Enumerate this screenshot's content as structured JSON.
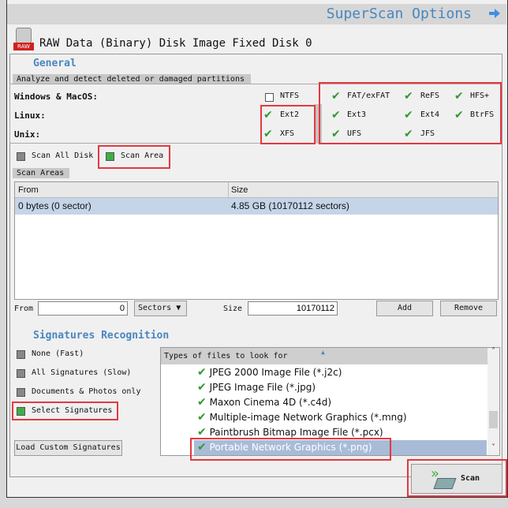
{
  "header": {
    "title": "SuperScan Options",
    "next_icon": "arrow-right-icon"
  },
  "disk": {
    "icon": "raw-disk-icon",
    "icon_label": "RAW",
    "name": "RAW Data (Binary) Disk Image Fixed Disk 0"
  },
  "general": {
    "heading": "General",
    "tab": "Analyze and detect deleted or damaged partitions",
    "rows": [
      {
        "label": "Windows & MacOS:",
        "fs": [
          {
            "name": "NTFS",
            "checked": false
          },
          {
            "name": "FAT/exFAT",
            "checked": true
          },
          {
            "name": "ReFS",
            "checked": true
          },
          {
            "name": "HFS+",
            "checked": true
          }
        ]
      },
      {
        "label": "Linux:",
        "fs": [
          {
            "name": "Ext2",
            "checked": true
          },
          {
            "name": "Ext3",
            "checked": true
          },
          {
            "name": "Ext4",
            "checked": true
          },
          {
            "name": "BtrFS",
            "checked": true
          }
        ]
      },
      {
        "label": "Unix:",
        "fs": [
          {
            "name": "XFS",
            "checked": true
          },
          {
            "name": "UFS",
            "checked": true
          },
          {
            "name": "JFS",
            "checked": true
          }
        ]
      }
    ],
    "scan_all_disk": "Scan All Disk",
    "scan_area": "Scan Area",
    "scan_mode": "Scan Area"
  },
  "scan_areas": {
    "tab": "Scan Areas",
    "columns": [
      "From",
      "Size"
    ],
    "rows": [
      {
        "from": "0 bytes (0 sector)",
        "size": "4.85 GB (10170112 sectors)"
      }
    ],
    "from_label": "From",
    "from_value": "0",
    "unit": "Sectors",
    "size_label": "Size",
    "size_value": "10170112",
    "add": "Add",
    "remove": "Remove"
  },
  "signatures": {
    "heading": "Signatures Recognition",
    "options": [
      "None (Fast)",
      "All Signatures (Slow)",
      "Documents & Photos only",
      "Select Signatures"
    ],
    "selected": "Select Signatures",
    "load_custom": "Load Custom Signatures",
    "list_header": "Types of files to look for",
    "items": [
      {
        "label": "JPEG 2000 Image File (*.j2c)",
        "checked": true
      },
      {
        "label": "JPEG Image File (*.jpg)",
        "checked": true
      },
      {
        "label": "Maxon Cinema 4D (*.c4d)",
        "checked": true
      },
      {
        "label": "Multiple-image Network Graphics (*.mng)",
        "checked": true
      },
      {
        "label": "Paintbrush Bitmap Image File (*.pcx)",
        "checked": true
      },
      {
        "label": "Portable Network Graphics (*.png)",
        "checked": true,
        "selected": true
      }
    ]
  },
  "scan_button": "Scan",
  "colors": {
    "accent": "#4a86c0",
    "highlight": "#e53840",
    "selection": "#c5d5e8",
    "check": "#2e9a2e"
  }
}
